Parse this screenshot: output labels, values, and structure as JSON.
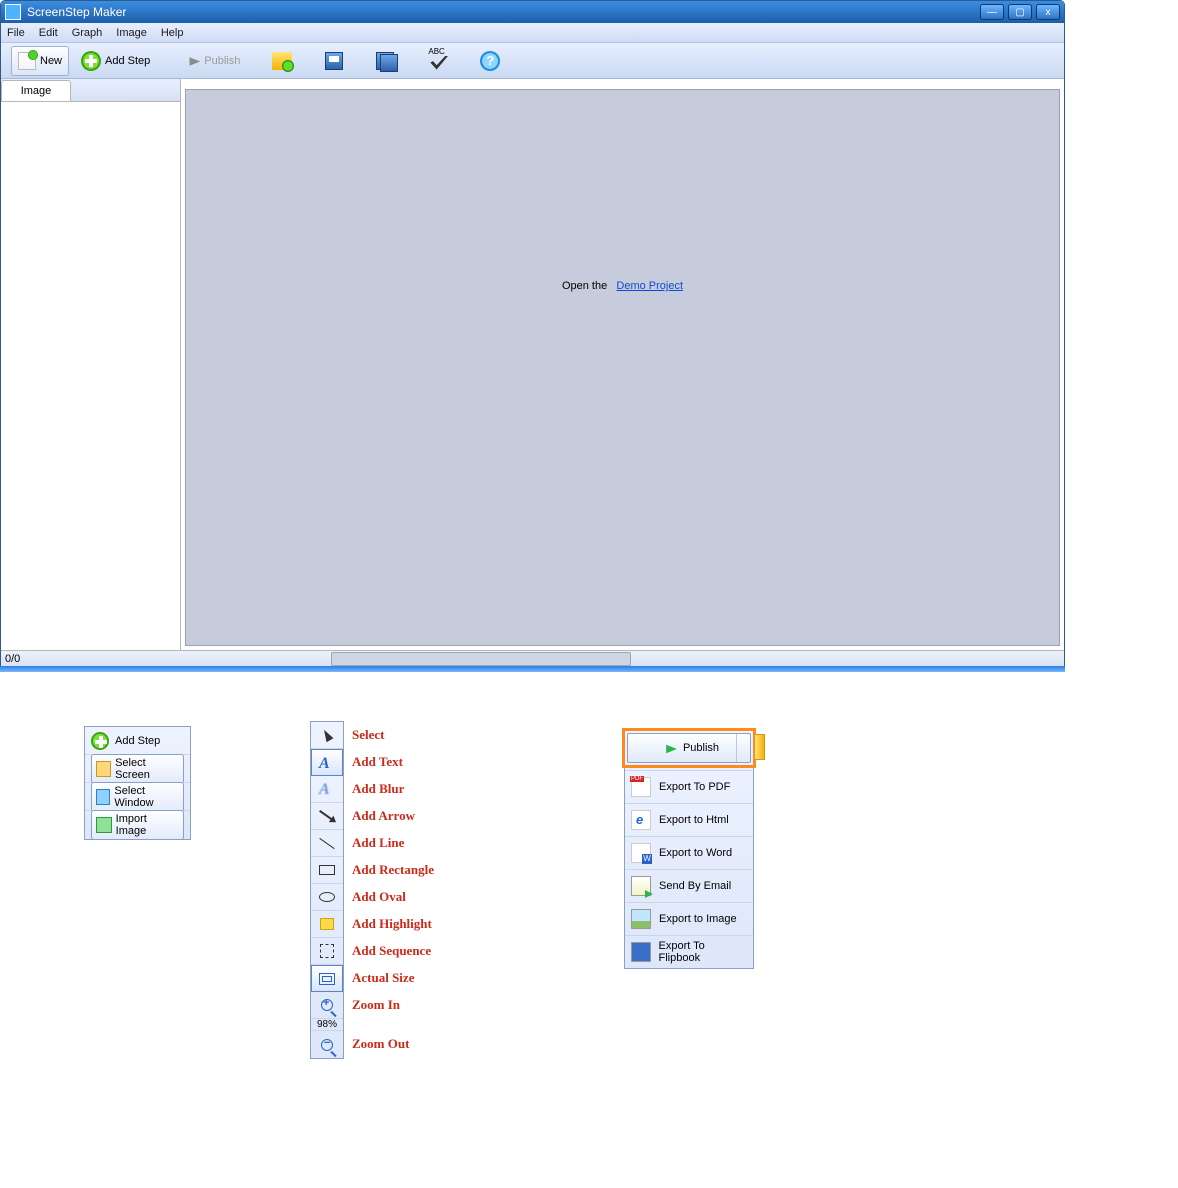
{
  "window": {
    "title": "ScreenStep Maker"
  },
  "menu": {
    "file": "File",
    "edit": "Edit",
    "graph": "Graph",
    "image": "Image",
    "help": "Help"
  },
  "toolbar": {
    "new": "New",
    "add_step": "Add Step",
    "publish": "Publish",
    "spell_abc": "ABC"
  },
  "sidebar": {
    "tab_image": "Image"
  },
  "canvas": {
    "open_the": "Open the",
    "demo_link": "Demo Project"
  },
  "status": {
    "counter": "0/0"
  },
  "addstep_menu": {
    "add_step": "Add Step",
    "select_screen": "Select Screen",
    "select_window": "Select Window",
    "import_image": "Import Image"
  },
  "tools": {
    "zoom_pct": "98%",
    "labels": {
      "select": "Select",
      "add_text": "Add Text",
      "add_blur": "Add Blur",
      "add_arrow": "Add Arrow",
      "add_line": "Add Line",
      "add_rect": "Add Rectangle",
      "add_oval": "Add Oval",
      "add_highlight": "Add Highlight",
      "add_sequence": "Add Sequence",
      "actual_size": "Actual Size",
      "zoom_in": "Zoom In",
      "zoom_out": "Zoom Out"
    }
  },
  "publish_menu": {
    "publish": "Publish",
    "export_pdf": "Export To PDF",
    "export_html": "Export to Html",
    "export_word": "Export to Word",
    "send_email": "Send By Email",
    "export_image": "Export to Image",
    "export_flipbook": "Export To Flipbook"
  }
}
